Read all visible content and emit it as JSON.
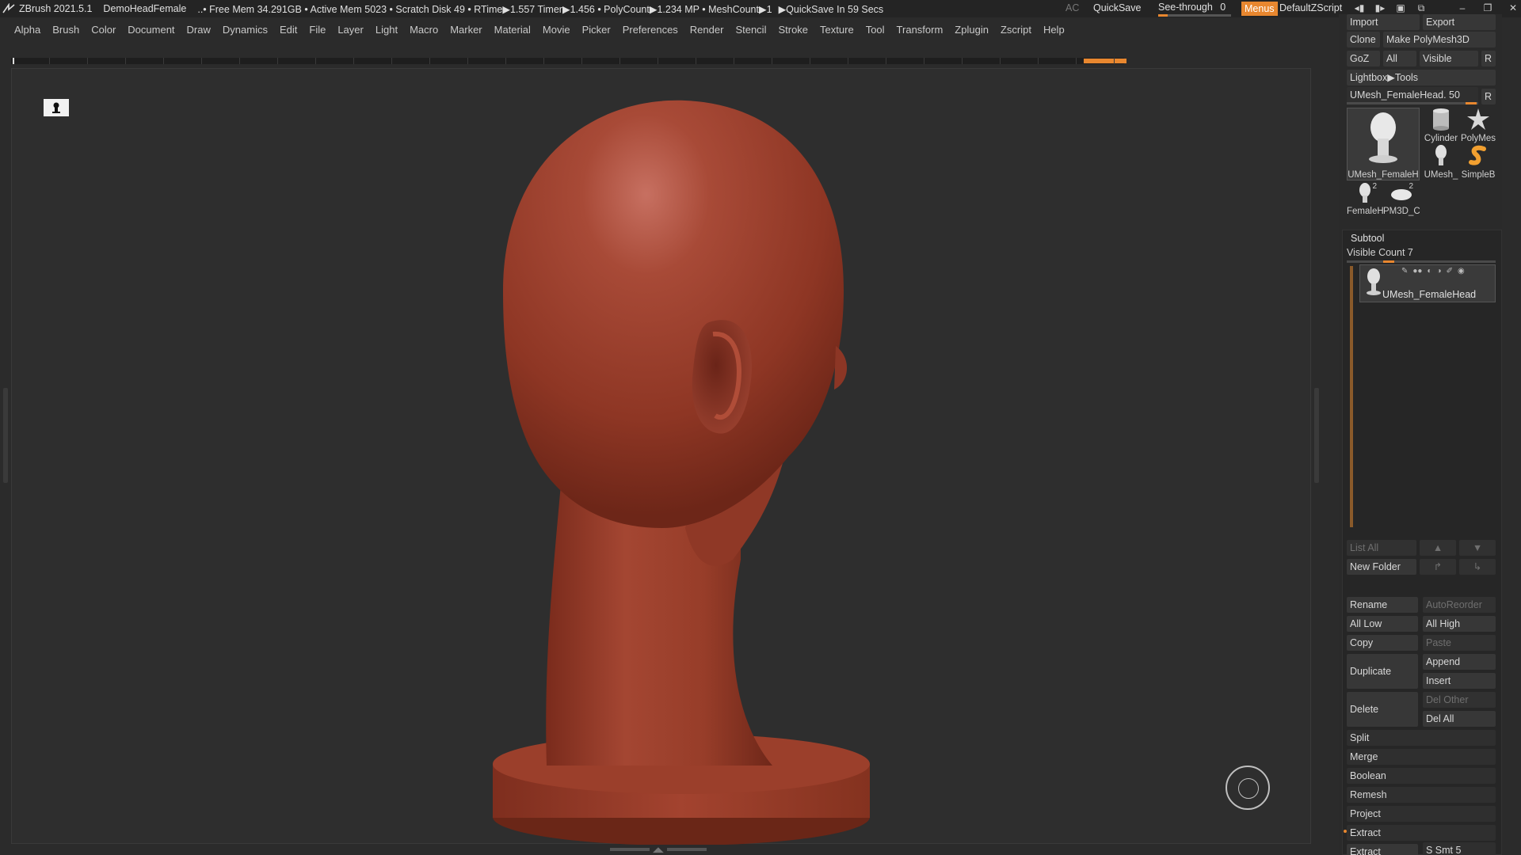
{
  "titlebar": {
    "app": "ZBrush 2021.5.1",
    "doc": "DemoHeadFemale",
    "stats": "..• Free Mem 34.291GB • Active Mem 5023 • Scratch Disk 49 • RTime▶1.557 Timer▶1.456 • PolyCount▶1.234 MP • MeshCount▶1",
    "autosave": "▶QuickSave In 59 Secs",
    "ac": "AC",
    "quicksave": "QuickSave",
    "seethrough_label": "See-through",
    "seethrough_value": "0",
    "menus": "Menus",
    "default_zscript": "DefaultZScript"
  },
  "menubar": [
    "Alpha",
    "Brush",
    "Color",
    "Document",
    "Draw",
    "Dynamics",
    "Edit",
    "File",
    "Layer",
    "Light",
    "Macro",
    "Marker",
    "Material",
    "Movie",
    "Picker",
    "Preferences",
    "Render",
    "Stencil",
    "Stroke",
    "Texture",
    "Tool",
    "Transform",
    "Zplugin",
    "Zscript",
    "Help"
  ],
  "tool": {
    "import": "Import",
    "export": "Export",
    "clone": "Clone",
    "make_polymesh": "Make PolyMesh3D",
    "goz": "GoZ",
    "all": "All",
    "visible": "Visible",
    "r": "R",
    "lightbox_tools": "Lightbox▶Tools",
    "current_tool": "UMesh_FemaleHead. 50",
    "thumbs": {
      "head_large": "UMesh_FemaleH",
      "cylinder": "Cylinder",
      "polymesh": "PolyMes",
      "umesh": "UMesh_",
      "simpleb": "SimpleB",
      "female": "FemaleH",
      "female_count": "2",
      "pm3d": "PM3D_C",
      "pm3d_count": "2"
    }
  },
  "subtool": {
    "title": "Subtool",
    "visible_count": "Visible Count 7",
    "visible_count_level": 0.35,
    "item_name": "UMesh_FemaleHead",
    "list_all": "List All",
    "new_folder": "New Folder",
    "rename": "Rename",
    "autoreorder": "AutoReorder",
    "all_low": "All Low",
    "all_high": "All High",
    "copy": "Copy",
    "paste": "Paste",
    "duplicate": "Duplicate",
    "append": "Append",
    "insert": "Insert",
    "delete": "Delete",
    "del_other": "Del Other",
    "del_all": "Del All",
    "split": "Split",
    "merge": "Merge",
    "boolean": "Boolean",
    "remesh": "Remesh",
    "project": "Project",
    "extract": "Extract",
    "extract_btn": "Extract",
    "s_smt": "S Smt 5",
    "s_smt_level": 0.2
  },
  "colors": {
    "accent": "#e8872f",
    "clay": "#a8412d"
  }
}
